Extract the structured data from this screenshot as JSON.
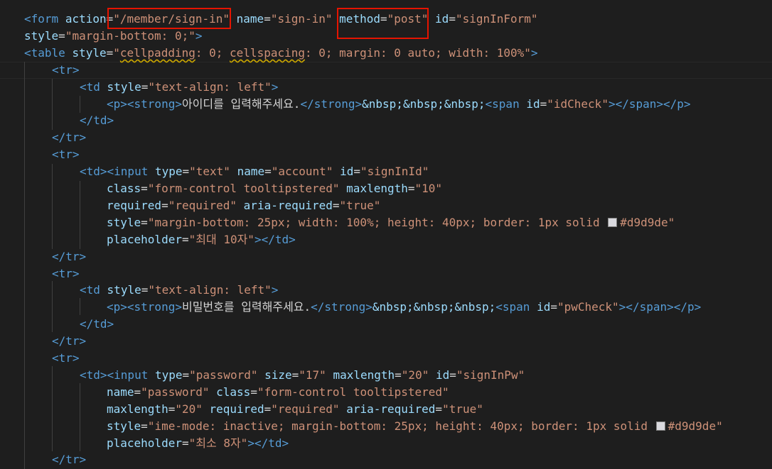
{
  "editor": {
    "theme_colors": {
      "background": "#1e1e1e",
      "tag": "#569cd6",
      "attribute": "#9cdcfe",
      "string": "#ce9178",
      "text": "#d4d4d4",
      "annotation_box": "#e51400",
      "color_swatch": "#d9d9de"
    },
    "lines": [
      {
        "indent": 0,
        "tokens": [
          [
            "tag",
            "<form"
          ],
          [
            "text",
            " "
          ],
          [
            "attr",
            "action"
          ],
          [
            "text",
            "="
          ],
          [
            "str",
            "\"/member/sign-in\""
          ],
          [
            "text",
            " "
          ],
          [
            "attr",
            "name"
          ],
          [
            "text",
            "="
          ],
          [
            "str",
            "\"sign-in\""
          ],
          [
            "text",
            " "
          ],
          [
            "attr",
            "method"
          ],
          [
            "text",
            "="
          ],
          [
            "str",
            "\"post\""
          ],
          [
            "text",
            " "
          ],
          [
            "attr",
            "id"
          ],
          [
            "text",
            "="
          ],
          [
            "str",
            "\"signInForm\""
          ]
        ]
      },
      {
        "indent": 0,
        "tokens": [
          [
            "attr",
            "style"
          ],
          [
            "text",
            "="
          ],
          [
            "str",
            "\"margin-bottom: 0;\""
          ],
          [
            "tag",
            ">"
          ]
        ]
      },
      {
        "indent": 0,
        "tokens": [
          [
            "tag",
            "<table"
          ],
          [
            "text",
            " "
          ],
          [
            "attr",
            "style"
          ],
          [
            "text",
            "="
          ],
          [
            "str",
            "\""
          ],
          [
            "strw",
            "cellpadding"
          ],
          [
            "str",
            ": 0; "
          ],
          [
            "strw",
            "cellspacing"
          ],
          [
            "str",
            ": 0; margin: 0 auto; width: 100%\""
          ],
          [
            "tag",
            ">"
          ]
        ]
      },
      {
        "indent": 1,
        "tokens": [
          [
            "tag",
            "<tr>"
          ]
        ]
      },
      {
        "indent": 2,
        "tokens": [
          [
            "tag",
            "<td"
          ],
          [
            "text",
            " "
          ],
          [
            "attr",
            "style"
          ],
          [
            "text",
            "="
          ],
          [
            "str",
            "\"text-align: left\""
          ],
          [
            "tag",
            ">"
          ]
        ]
      },
      {
        "indent": 3,
        "tokens": [
          [
            "tag",
            "<p><strong>"
          ],
          [
            "text",
            "아이디를 입력해주세요."
          ],
          [
            "tag",
            "</strong>"
          ],
          [
            "ent",
            "&nbsp;&nbsp;&nbsp;"
          ],
          [
            "tag",
            "<span"
          ],
          [
            "text",
            " "
          ],
          [
            "attr",
            "id"
          ],
          [
            "text",
            "="
          ],
          [
            "str",
            "\"idCheck\""
          ],
          [
            "tag",
            "></span></p>"
          ]
        ]
      },
      {
        "indent": 2,
        "tokens": [
          [
            "tag",
            "</td>"
          ]
        ]
      },
      {
        "indent": 1,
        "tokens": [
          [
            "tag",
            "</tr>"
          ]
        ]
      },
      {
        "indent": 1,
        "tokens": [
          [
            "tag",
            "<tr>"
          ]
        ]
      },
      {
        "indent": 2,
        "tokens": [
          [
            "tag",
            "<td><input"
          ],
          [
            "text",
            " "
          ],
          [
            "attr",
            "type"
          ],
          [
            "text",
            "="
          ],
          [
            "str",
            "\"text\""
          ],
          [
            "text",
            " "
          ],
          [
            "attr",
            "name"
          ],
          [
            "text",
            "="
          ],
          [
            "str",
            "\"account\""
          ],
          [
            "text",
            " "
          ],
          [
            "attr",
            "id"
          ],
          [
            "text",
            "="
          ],
          [
            "str",
            "\"signInId\""
          ]
        ]
      },
      {
        "indent": 3,
        "tokens": [
          [
            "attr",
            "class"
          ],
          [
            "text",
            "="
          ],
          [
            "str",
            "\"form-control tooltipstered\""
          ],
          [
            "text",
            " "
          ],
          [
            "attr",
            "maxlength"
          ],
          [
            "text",
            "="
          ],
          [
            "str",
            "\"10\""
          ]
        ]
      },
      {
        "indent": 3,
        "tokens": [
          [
            "attr",
            "required"
          ],
          [
            "text",
            "="
          ],
          [
            "str",
            "\"required\""
          ],
          [
            "text",
            " "
          ],
          [
            "attr",
            "aria-required"
          ],
          [
            "text",
            "="
          ],
          [
            "str",
            "\"true\""
          ]
        ]
      },
      {
        "indent": 3,
        "tokens": [
          [
            "attr",
            "style"
          ],
          [
            "text",
            "="
          ],
          [
            "str",
            "\"margin-bottom: 25px; width: 100%; height: 40px; border: 1px solid "
          ],
          [
            "swatch",
            "#d9d9de"
          ],
          [
            "str",
            "#d9d9de\""
          ]
        ]
      },
      {
        "indent": 3,
        "tokens": [
          [
            "attr",
            "placeholder"
          ],
          [
            "text",
            "="
          ],
          [
            "str",
            "\"최대 10자\""
          ],
          [
            "tag",
            "></td>"
          ]
        ]
      },
      {
        "indent": 1,
        "tokens": [
          [
            "tag",
            "</tr>"
          ]
        ]
      },
      {
        "indent": 1,
        "tokens": [
          [
            "tag",
            "<tr>"
          ]
        ]
      },
      {
        "indent": 2,
        "tokens": [
          [
            "tag",
            "<td"
          ],
          [
            "text",
            " "
          ],
          [
            "attr",
            "style"
          ],
          [
            "text",
            "="
          ],
          [
            "str",
            "\"text-align: left\""
          ],
          [
            "tag",
            ">"
          ]
        ]
      },
      {
        "indent": 3,
        "tokens": [
          [
            "tag",
            "<p><strong>"
          ],
          [
            "text",
            "비밀번호를 입력해주세요."
          ],
          [
            "tag",
            "</strong>"
          ],
          [
            "ent",
            "&nbsp;&nbsp;&nbsp;"
          ],
          [
            "tag",
            "<span"
          ],
          [
            "text",
            " "
          ],
          [
            "attr",
            "id"
          ],
          [
            "text",
            "="
          ],
          [
            "str",
            "\"pwCheck\""
          ],
          [
            "tag",
            "></span></p>"
          ]
        ]
      },
      {
        "indent": 2,
        "tokens": [
          [
            "tag",
            "</td>"
          ]
        ]
      },
      {
        "indent": 1,
        "tokens": [
          [
            "tag",
            "</tr>"
          ]
        ]
      },
      {
        "indent": 1,
        "tokens": [
          [
            "tag",
            "<tr>"
          ]
        ]
      },
      {
        "indent": 2,
        "tokens": [
          [
            "tag",
            "<td><input"
          ],
          [
            "text",
            " "
          ],
          [
            "attr",
            "type"
          ],
          [
            "text",
            "="
          ],
          [
            "str",
            "\"password\""
          ],
          [
            "text",
            " "
          ],
          [
            "attr",
            "size"
          ],
          [
            "text",
            "="
          ],
          [
            "str",
            "\"17\""
          ],
          [
            "text",
            " "
          ],
          [
            "attr",
            "maxlength"
          ],
          [
            "text",
            "="
          ],
          [
            "str",
            "\"20\""
          ],
          [
            "text",
            " "
          ],
          [
            "attr",
            "id"
          ],
          [
            "text",
            "="
          ],
          [
            "str",
            "\"signInPw\""
          ]
        ]
      },
      {
        "indent": 3,
        "tokens": [
          [
            "attr",
            "name"
          ],
          [
            "text",
            "="
          ],
          [
            "str",
            "\"password\""
          ],
          [
            "text",
            " "
          ],
          [
            "attr",
            "class"
          ],
          [
            "text",
            "="
          ],
          [
            "str",
            "\"form-control tooltipstered\""
          ]
        ]
      },
      {
        "indent": 3,
        "tokens": [
          [
            "attr",
            "maxlength"
          ],
          [
            "text",
            "="
          ],
          [
            "str",
            "\"20\""
          ],
          [
            "text",
            " "
          ],
          [
            "attr",
            "required"
          ],
          [
            "text",
            "="
          ],
          [
            "str",
            "\"required\""
          ],
          [
            "text",
            " "
          ],
          [
            "attr",
            "aria-required"
          ],
          [
            "text",
            "="
          ],
          [
            "str",
            "\"true\""
          ]
        ]
      },
      {
        "indent": 3,
        "tokens": [
          [
            "attr",
            "style"
          ],
          [
            "text",
            "="
          ],
          [
            "str",
            "\"ime-mode: inactive; margin-bottom: 25px; height: 40px; border: 1px solid "
          ],
          [
            "swatch",
            "#d9d9de"
          ],
          [
            "str",
            "#d9d9de\""
          ]
        ]
      },
      {
        "indent": 3,
        "tokens": [
          [
            "attr",
            "placeholder"
          ],
          [
            "text",
            "="
          ],
          [
            "str",
            "\"최소 8자\""
          ],
          [
            "tag",
            "></td>"
          ]
        ]
      },
      {
        "indent": 1,
        "tokens": [
          [
            "tag",
            "</tr>"
          ]
        ]
      }
    ],
    "annotations": [
      {
        "label": "action-value-highlight",
        "line": 0,
        "text": "\"/member/sign-in\""
      },
      {
        "label": "method-attribute-highlight",
        "line": 0,
        "text": "method=\"post\""
      }
    ]
  }
}
